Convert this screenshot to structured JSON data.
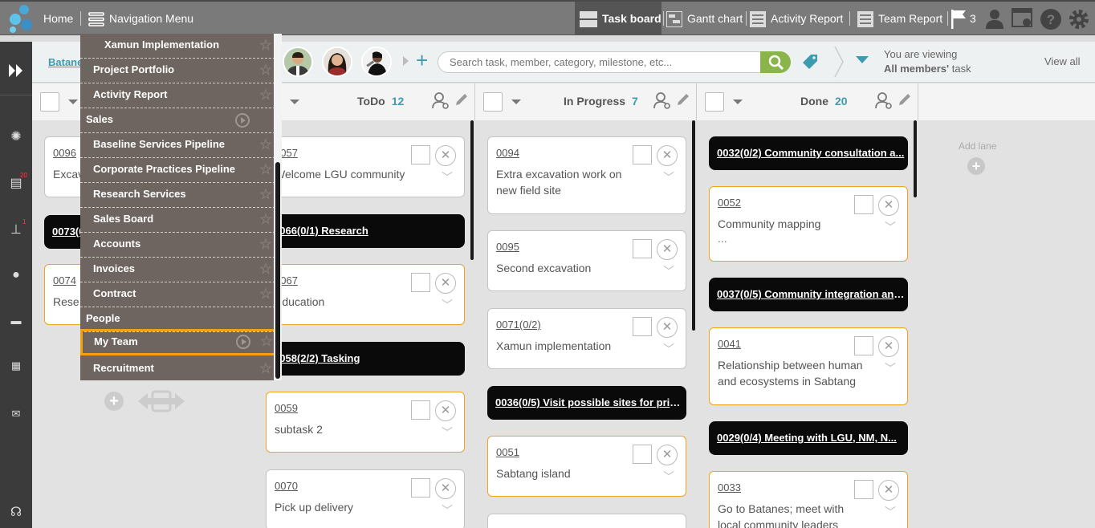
{
  "topbar": {
    "home": "Home",
    "nav_menu": "Navigation Menu",
    "views": [
      "Task board",
      "Gantt chart",
      "Activity Report",
      "Team Report"
    ],
    "flag_count": "3"
  },
  "rail": {
    "calendar_badge": "20",
    "stamp_badge": "1"
  },
  "toolbar": {
    "project_link": "Batane",
    "search_placeholder": "Search task, member, category, milestone, etc...",
    "viewing_line1": "You are viewing",
    "viewing_bold": "All members'",
    "viewing_rest": " task",
    "view_all": "View all"
  },
  "lanes": {
    "todo": {
      "title": "ToDo",
      "count": "12"
    },
    "inprogress": {
      "title": "In Progress",
      "count": "7"
    },
    "done": {
      "title": "Done",
      "count": "20"
    },
    "add_lane": "Add lane"
  },
  "backlog_cards": [
    {
      "id": "0096",
      "title": "Excav"
    },
    {
      "id": "0073(0",
      "title": ""
    },
    {
      "id": "0074",
      "title": "Rese"
    }
  ],
  "todo_cards": {
    "c1": {
      "id": "0057",
      "title": "Welcome LGU community"
    },
    "g1": "0066(0/1) Research",
    "c2": {
      "id": "0067",
      "title": "Education"
    },
    "g2": "0058(2/2) Tasking",
    "c3": {
      "id": "0059",
      "title": "subtask 2"
    },
    "c4": {
      "id": "0070",
      "title": "Pick up delivery"
    }
  },
  "progress_cards": {
    "c1": {
      "id": "0094",
      "title": "Extra excavation work on new field site"
    },
    "c2": {
      "id": "0095",
      "title": "Second excavation"
    },
    "c3": {
      "id": "0071(0/2)",
      "title": "Xamun implementation"
    },
    "g1": "0036(0/5) Visit possible sites for prior...",
    "c4": {
      "id": "0051",
      "title": "Sabtang island"
    }
  },
  "done_cards": {
    "g1": "0032(0/2) Community consultation a...",
    "c1": {
      "id": "0052",
      "title": "Community mapping",
      "more": "..."
    },
    "g2": "0037(0/5) Community integration and...",
    "c2": {
      "id": "0041",
      "title": "Relationship between human and ecosystems in Sabtang"
    },
    "g3": "0029(0/4) Meeting with LGU, NM, N...",
    "c3": {
      "id": "0033",
      "title": "Go to Batanes; meet with local community leaders"
    }
  },
  "nav_menu": {
    "items": [
      "Xamun Implementation",
      "Project Portfolio",
      "Activity Report",
      "Sales",
      "Baseline Services Pipeline",
      "Corporate Practices Pipeline",
      "Research Services",
      "Sales Board",
      "Accounts",
      "Invoices",
      "Contract",
      "People",
      "My Team",
      "Recruitment"
    ]
  },
  "colors": {
    "highlight": "#f5a00c",
    "accent": "#3d9bb0",
    "search_green": "#8ab54a"
  }
}
